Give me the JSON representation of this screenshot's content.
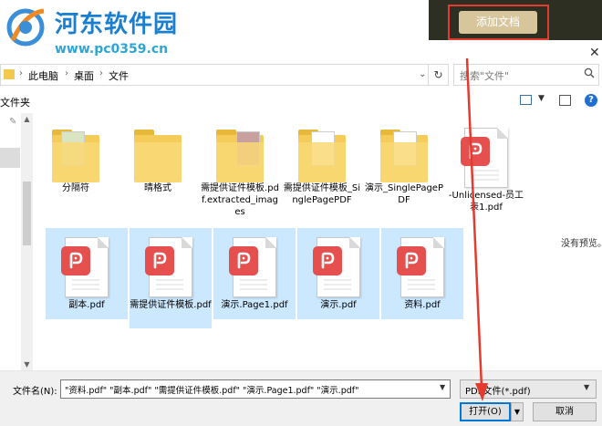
{
  "watermark": {
    "site_name": "河东软件园",
    "url": "www.pc0359.cn"
  },
  "app_toolbar": {
    "add_document_label": "添加文档"
  },
  "dialog": {
    "close_glyph": "✕",
    "breadcrumb": [
      "此电脑",
      "桌面",
      "文件"
    ],
    "refresh_glyph": "↻",
    "search_placeholder": "搜索\"文件\"",
    "toolbar_left_label": "文件夹",
    "help_glyph": "?",
    "preview_message": "没有预览。"
  },
  "files": [
    {
      "name": "分隔符",
      "type": "folder",
      "selected": false
    },
    {
      "name": "晴格式",
      "type": "folder",
      "selected": false
    },
    {
      "name": "需提供证件模板.pdf.extracted_images",
      "type": "folder",
      "selected": false
    },
    {
      "name": "需提供证件模板_SinglePagePDF",
      "type": "folder",
      "selected": false
    },
    {
      "name": "演示_SinglePagePDF",
      "type": "folder",
      "selected": false
    },
    {
      "name": "-Unlicensed-员工表1.pdf",
      "type": "pdf",
      "selected": false
    },
    {
      "name": "副本.pdf",
      "type": "pdf",
      "selected": true
    },
    {
      "name": "需提供证件模板.pdf",
      "type": "pdf",
      "selected": true
    },
    {
      "name": "演示.Page1.pdf",
      "type": "pdf",
      "selected": true
    },
    {
      "name": "演示.pdf",
      "type": "pdf",
      "selected": true
    },
    {
      "name": "资料.pdf",
      "type": "pdf",
      "selected": true
    }
  ],
  "footer": {
    "filename_label": "文件名(N):",
    "filename_value": "\"资料.pdf\" \"副本.pdf\" \"需提供证件模板.pdf\" \"演示.Page1.pdf\" \"演示.pdf\"",
    "filetype_value": "PDF文件(*.pdf)",
    "open_label": "打开(O)",
    "cancel_label": "取消"
  },
  "colors": {
    "selection": "#cce8ff",
    "annotation_red": "#e53b2f",
    "pdf_badge": "#e5504f",
    "folder": "#f5cc5a"
  }
}
